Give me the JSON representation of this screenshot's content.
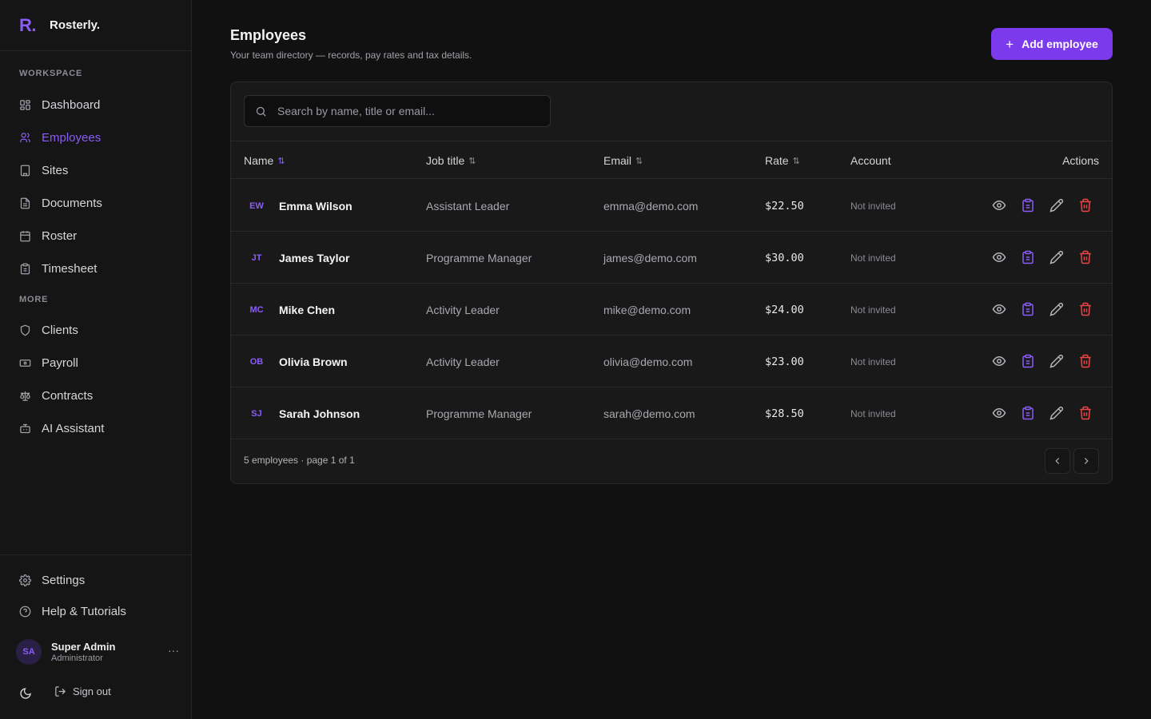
{
  "app": {
    "logo": "R.",
    "name": "Rosterly."
  },
  "colors": {
    "accent": "#7c3aed",
    "accent_text": "#8b5cf6",
    "danger": "#ef4444",
    "background": "#111112",
    "sidebar": "#151516"
  },
  "sidebar": {
    "workspace_label": "WORKSPACE",
    "more_label": "MORE",
    "workspace_items": [
      {
        "label": "Dashboard",
        "icon": "grid-icon"
      },
      {
        "label": "Employees",
        "icon": "users-icon",
        "active": true
      },
      {
        "label": "Sites",
        "icon": "building-icon"
      },
      {
        "label": "Documents",
        "icon": "file-icon"
      },
      {
        "label": "Roster",
        "icon": "calendar-icon"
      },
      {
        "label": "Timesheet",
        "icon": "clipboard-icon"
      }
    ],
    "more_items": [
      {
        "label": "Clients",
        "icon": "shield-icon"
      },
      {
        "label": "Payroll",
        "icon": "banknote-icon"
      },
      {
        "label": "Contracts",
        "icon": "scale-icon"
      },
      {
        "label": "AI Assistant",
        "icon": "bot-icon"
      }
    ],
    "bottom_items": [
      {
        "label": "Settings",
        "icon": "gear-icon"
      },
      {
        "label": "Help & Tutorials",
        "icon": "help-circle-icon"
      }
    ],
    "user": {
      "initials": "SA",
      "name": "Super Admin",
      "role": "Administrator",
      "more": "···"
    },
    "sign_out": "Sign out"
  },
  "header": {
    "title": "Employees",
    "subtitle": "Your team directory — records, pay rates and tax details.",
    "add_button": "Add employee"
  },
  "search": {
    "placeholder": "Search by name, title or email..."
  },
  "table": {
    "columns": {
      "name": "Name",
      "job": "Job title",
      "email": "Email",
      "rate": "Rate",
      "account": "Account",
      "actions": "Actions"
    },
    "sort_glyph": "⇅",
    "rows": [
      {
        "initials": "EW",
        "name": "Emma Wilson",
        "job": "Assistant Leader",
        "email": "emma@demo.com",
        "rate": "$22.50",
        "account": "Not invited"
      },
      {
        "initials": "JT",
        "name": "James Taylor",
        "job": "Programme Manager",
        "email": "james@demo.com",
        "rate": "$30.00",
        "account": "Not invited"
      },
      {
        "initials": "MC",
        "name": "Mike Chen",
        "job": "Activity Leader",
        "email": "mike@demo.com",
        "rate": "$24.00",
        "account": "Not invited"
      },
      {
        "initials": "OB",
        "name": "Olivia Brown",
        "job": "Activity Leader",
        "email": "olivia@demo.com",
        "rate": "$23.00",
        "account": "Not invited"
      },
      {
        "initials": "SJ",
        "name": "Sarah Johnson",
        "job": "Programme Manager",
        "email": "sarah@demo.com",
        "rate": "$28.50",
        "account": "Not invited"
      }
    ]
  },
  "footer": {
    "summary": "5 employees · page 1 of 1"
  }
}
